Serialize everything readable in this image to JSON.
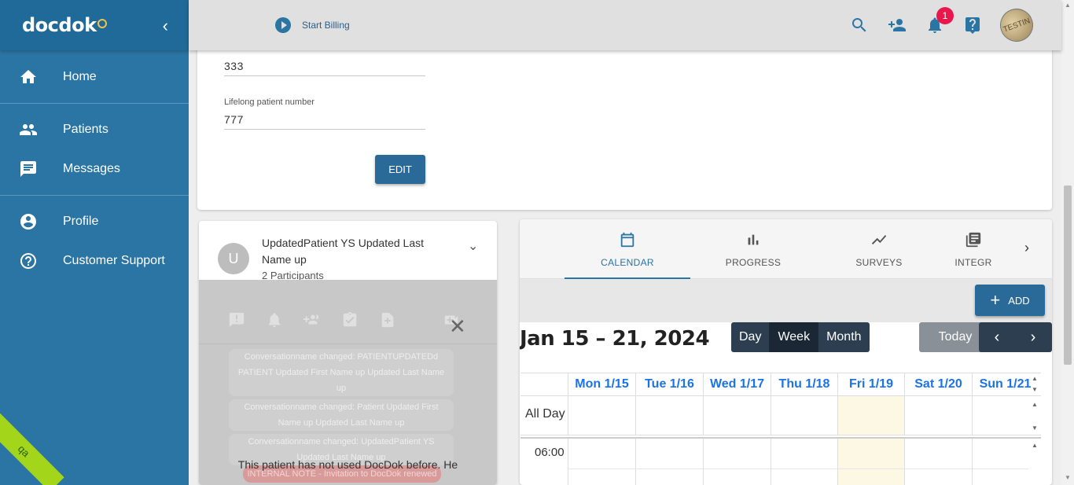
{
  "sidebar": {
    "logo": "docdok",
    "collapse_icon": "‹",
    "items": [
      {
        "label": "Home",
        "icon": "home-icon"
      },
      {
        "label": "Patients",
        "icon": "people-icon"
      },
      {
        "label": "Messages",
        "icon": "message-icon"
      },
      {
        "label": "Profile",
        "icon": "account-circle-icon"
      },
      {
        "label": "Customer Support",
        "icon": "help-circle-icon"
      }
    ],
    "env_ribbon": "qa"
  },
  "topbar": {
    "billing_label": "Start Billing",
    "notification_count": "1",
    "avatar_text": "TESTIN"
  },
  "form": {
    "field1_value": "333",
    "field2_label": "Lifelong patient number",
    "field2_value": "777",
    "edit_label": "EDIT"
  },
  "conversation": {
    "avatar_initial": "U",
    "title": "UpdatedPatient YS Updated Last Name up",
    "participants": "2 Participants",
    "messages": [
      "Conversationname changed: PATIENTUPDATEDd PATIENT Updated First Name up Updated Last Name up",
      "Conversationname changed: Patient Updated First Name up Updated Last Name up",
      "Conversationname changed: UpdatedPatient YS Updated Last Name up"
    ],
    "internal_note": "INTERNAL NOTE - Invitation to DocDok renewed",
    "notice": "This patient has not used DocDok before. He"
  },
  "tabs": {
    "items": [
      {
        "label": "CALENDAR",
        "icon": "calendar-icon",
        "active": true
      },
      {
        "label": "PROGRESS",
        "icon": "bar-chart-icon",
        "active": false
      },
      {
        "label": "SURVEYS",
        "icon": "trend-line-icon",
        "active": false
      },
      {
        "label": "INTEGR",
        "icon": "library-icon",
        "active": false
      }
    ]
  },
  "calendar": {
    "add_label": "ADD",
    "title": "Jan 15 – 21, 2024",
    "views": [
      "Day",
      "Week",
      "Month"
    ],
    "active_view": "Week",
    "today_label": "Today",
    "days": [
      "Mon 1/15",
      "Tue 1/16",
      "Wed 1/17",
      "Thu 1/18",
      "Fri 1/19",
      "Sat 1/20",
      "Sun 1/21"
    ],
    "today_day": "Fri 1/19",
    "all_day_label": "All Day",
    "first_hour": "06:00"
  },
  "colors": {
    "sidebar": "#2a75a3",
    "accent": "#2a6a99",
    "badge": "#e8184d",
    "today_highlight": "#fcf8e3",
    "day_header": "#1a73e8"
  }
}
